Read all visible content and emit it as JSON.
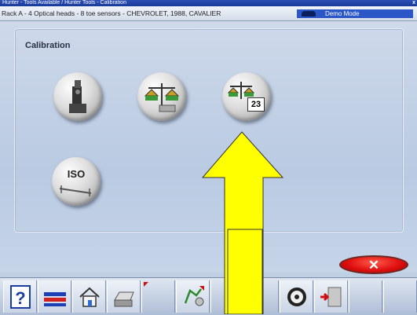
{
  "window": {
    "title": "Hunter - Tools Available / Hunter Tools - Calibration",
    "close_glyph": "x"
  },
  "status": {
    "vehicle_info": "Rack A - 4 Optical heads - 8 toe sensors - CHEVROLET, 1988, CAVALIER",
    "mode_label": "Demo Mode"
  },
  "section": {
    "title": "Calibration"
  },
  "tools": {
    "calendar_day": "23",
    "iso_label": "ISO"
  },
  "dialog": {
    "cancel_glyph": "✕"
  },
  "toolbar": {
    "help_glyph": "?",
    "icons": [
      "help-icon",
      "rack-icon",
      "home-icon",
      "printer-icon",
      "alignment-icon",
      "steering-wheel-icon",
      "exit-icon"
    ]
  },
  "colors": {
    "accent_blue": "#2b56c7",
    "cancel_red": "#e01010",
    "arrow_yellow": "#ffff00"
  }
}
